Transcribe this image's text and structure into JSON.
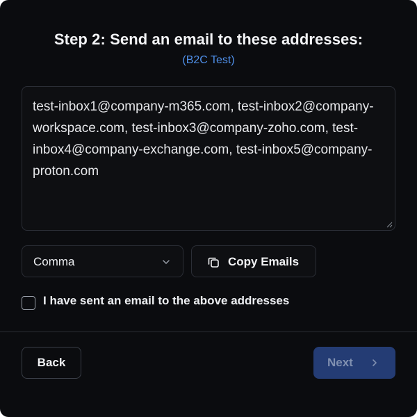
{
  "header": {
    "title": "Step 2: Send an email to these addresses:",
    "subtitle": "(B2C Test)"
  },
  "emails_textarea": {
    "value": "test-inbox1@company-m365.com, test-inbox2@company-workspace.com, test-inbox3@company-zoho.com, test-inbox4@company-exchange.com, test-inbox5@company-proton.com"
  },
  "separator_select": {
    "selected": "Comma"
  },
  "copy_button": {
    "label": "Copy Emails",
    "icon": "copy-icon"
  },
  "confirm_checkbox": {
    "label": "I have sent an email to the above addresses",
    "checked": false
  },
  "footer": {
    "back_label": "Back",
    "next_label": "Next",
    "next_icon": "chevron-right-icon",
    "next_disabled": true
  },
  "colors": {
    "background": "#0b0c0f",
    "accent": "#4f8fe8",
    "next_button_bg": "#243c74",
    "border": "#2b2e36"
  }
}
